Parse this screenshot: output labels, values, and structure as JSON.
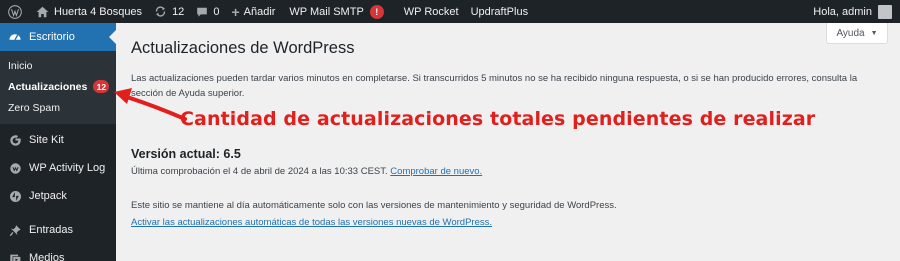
{
  "adminbar": {
    "site_name": "Huerta 4 Bosques",
    "updates_count": "12",
    "comments_count": "0",
    "new_label": "Añadir",
    "smtp_label": "WP Mail SMTP",
    "smtp_badge": "!",
    "rocket_label": "WP Rocket",
    "updraft_label": "UpdraftPlus",
    "greeting": "Hola, admin"
  },
  "sidebar": {
    "dashboard_label": "Escritorio",
    "submenu": {
      "home": "Inicio",
      "updates": "Actualizaciones",
      "updates_count": "12",
      "zero_spam": "Zero Spam"
    },
    "items": [
      {
        "label": "Site Kit",
        "icon": "site-kit-icon"
      },
      {
        "label": "WP Activity Log",
        "icon": "activity-log-icon"
      },
      {
        "label": "Jetpack",
        "icon": "jetpack-icon"
      },
      {
        "label": "Entradas",
        "icon": "pin-icon"
      },
      {
        "label": "Medios",
        "icon": "media-icon"
      }
    ]
  },
  "main": {
    "help_label": "Ayuda",
    "title": "Actualizaciones de WordPress",
    "intro": "Las actualizaciones pueden tardar varios minutos en completarse. Si transcurridos 5 minutos no se ha recibido ninguna respuesta, o si se han producido errores, consulta la sección de Ayuda superior.",
    "current_version": "Versión actual: 6.5",
    "last_check": "Última comprobación el 4 de abril de 2024 a las 10:33 CEST.",
    "check_again": "Comprobar de nuevo.",
    "auto_text": "Este sitio se mantiene al día automáticamente solo con las versiones de mantenimiento y seguridad de WordPress.",
    "auto_link": "Activar las actualizaciones automáticas de todas las versiones nuevas de WordPress."
  },
  "annotation": {
    "text": "Cantidad de actualizaciones totales pendientes de realizar",
    "color": "#e1201d"
  },
  "colors": {
    "admin_dark": "#1d2327",
    "accent_blue": "#2271b1",
    "badge_red": "#d63638"
  }
}
